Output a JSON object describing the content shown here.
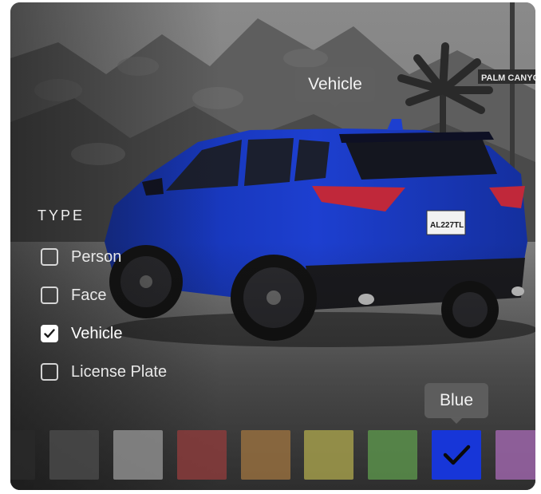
{
  "tooltips": {
    "detected_object": "Vehicle",
    "detected_color": "Blue"
  },
  "filters": {
    "heading": "TYPE",
    "options": [
      {
        "label": "Person",
        "checked": false
      },
      {
        "label": "Face",
        "checked": false
      },
      {
        "label": "Vehicle",
        "checked": true
      },
      {
        "label": "License Plate",
        "checked": false
      }
    ]
  },
  "scene": {
    "street_sign": "PALM CANYON D",
    "license_plate": "AL227TL"
  },
  "colors": {
    "selected": "Blue",
    "swatches": [
      {
        "hex": "#2a2a2a",
        "selected": false
      },
      {
        "hex": "#4b4b4b",
        "selected": false
      },
      {
        "hex": "#909090",
        "selected": false
      },
      {
        "hex": "#8c3c3c",
        "selected": false
      },
      {
        "hex": "#98703f",
        "selected": false
      },
      {
        "hex": "#a6a04c",
        "selected": false
      },
      {
        "hex": "#5c944c",
        "selected": false
      },
      {
        "hex": "#1736d8",
        "selected": true
      },
      {
        "hex": "#a066ad",
        "selected": false
      }
    ]
  }
}
